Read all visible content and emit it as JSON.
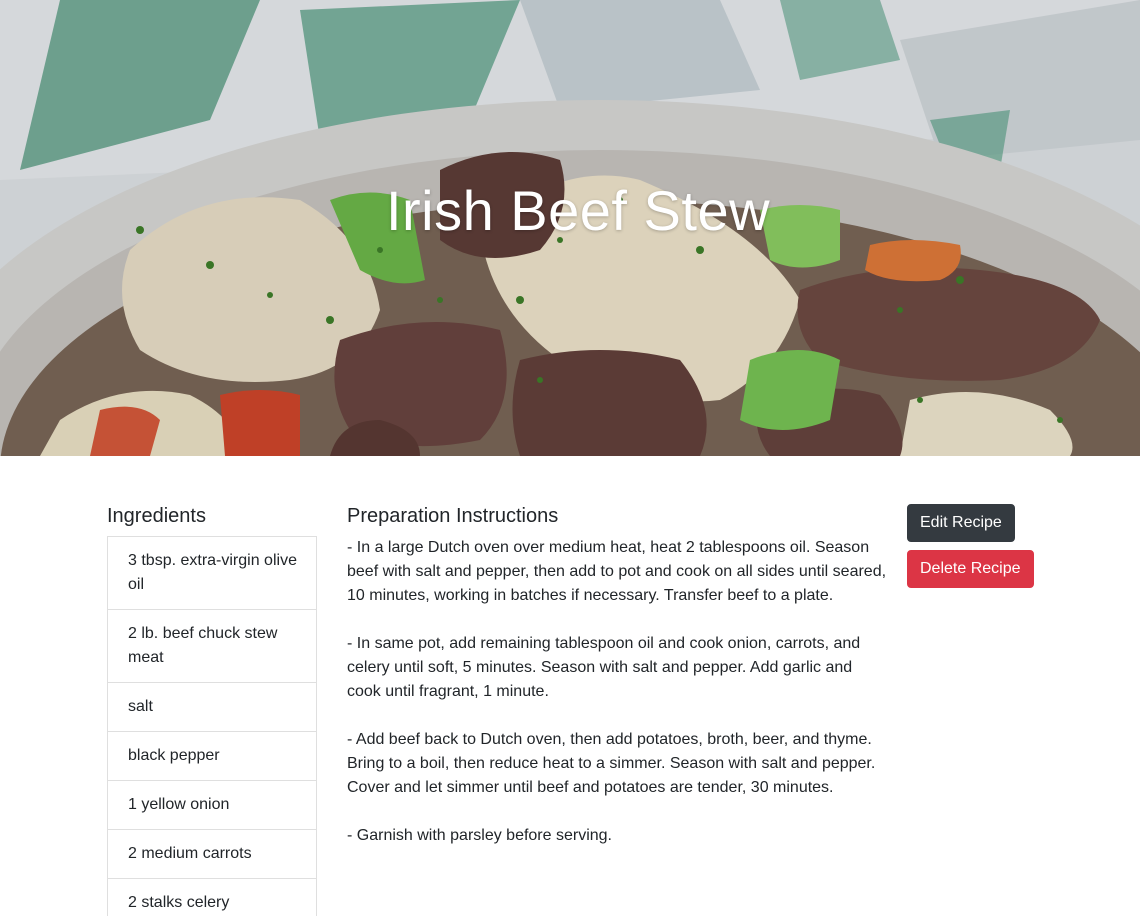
{
  "hero": {
    "title": "Irish Beef Stew"
  },
  "ingredients": {
    "heading": "Ingredients",
    "items": [
      "3 tbsp. extra-virgin olive oil",
      "2 lb. beef chuck stew meat",
      "salt",
      "black pepper",
      "1 yellow onion",
      "2 medium carrots",
      "2 stalks celery"
    ]
  },
  "instructions": {
    "heading": "Preparation Instructions",
    "steps": [
      "- In a large Dutch oven over medium heat, heat 2 tablespoons oil. Season beef with salt and pepper, then add to pot and cook on all sides until seared, 10 minutes, working in batches if necessary. Transfer beef to a plate.",
      "- In same pot, add remaining tablespoon oil and cook onion, carrots, and celery until soft, 5 minutes. Season with salt and pepper. Add garlic and cook until fragrant, 1 minute.",
      "- Add beef back to Dutch oven, then add potatoes, broth, beer, and thyme. Bring to a boil, then reduce heat to a simmer. Season with salt and pepper. Cover and let simmer until beef and potatoes are tender, 30 minutes.",
      "- Garnish with parsley before serving."
    ]
  },
  "actions": {
    "edit_label": "Edit Recipe",
    "delete_label": "Delete Recipe"
  },
  "colors": {
    "edit_button": "#343a40",
    "delete_button": "#dc3545"
  }
}
